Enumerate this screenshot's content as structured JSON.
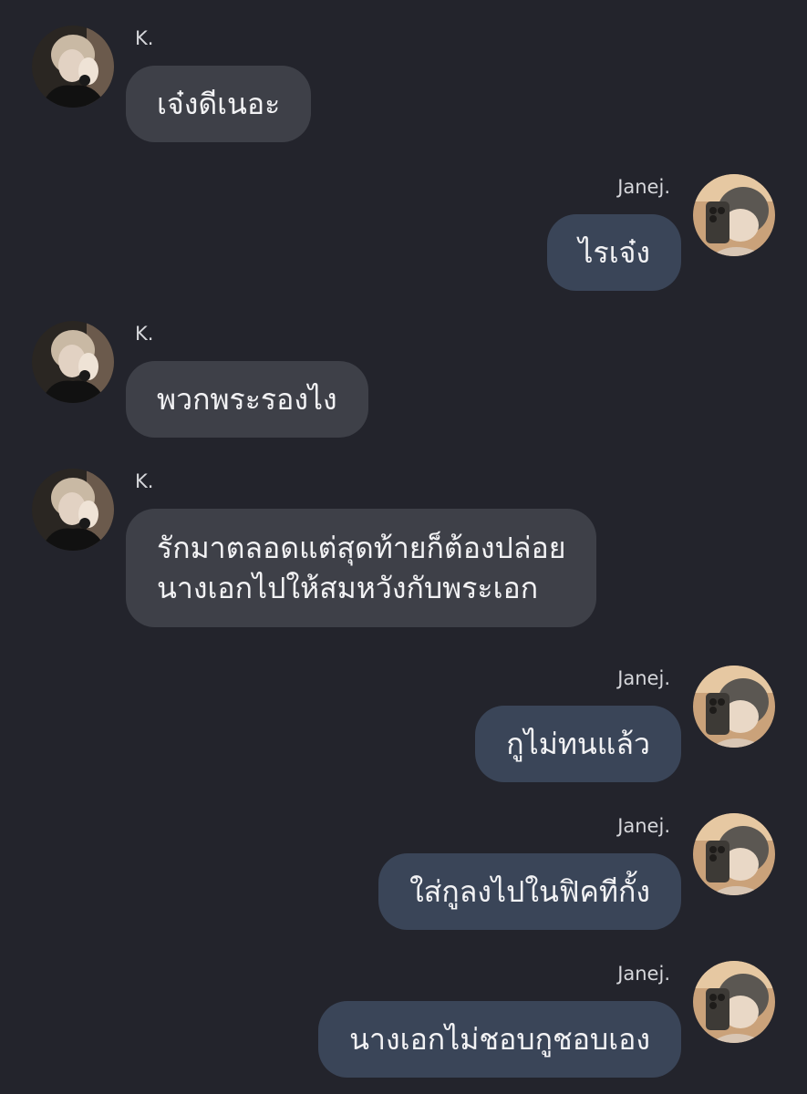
{
  "colors": {
    "background": "#23242c",
    "incoming_bubble": "#3e4048",
    "outgoing_bubble": "#3a4558",
    "text": "#f2f2f4"
  },
  "contacts": {
    "k": {
      "name": "K.",
      "avatar_icon": "profile-photo-k"
    },
    "janej": {
      "name": "Janej.",
      "avatar_icon": "profile-photo-janej"
    }
  },
  "messages": [
    {
      "sender": "K.",
      "direction": "incoming",
      "lines": [
        "เจ๋งดีเนอะ"
      ]
    },
    {
      "sender": "Janej.",
      "direction": "outgoing",
      "lines": [
        "ไรเจ๋ง"
      ]
    },
    {
      "sender": "K.",
      "direction": "incoming",
      "lines": [
        "พวกพระรองไง"
      ]
    },
    {
      "sender": "K.",
      "direction": "incoming",
      "lines": [
        "รักมาตลอดแต่สุดท้ายก็ต้องปล่อย",
        "นางเอกไปให้สมหวังกับพระเอก"
      ]
    },
    {
      "sender": "Janej.",
      "direction": "outgoing",
      "lines": [
        "กูไม่ทนแล้ว"
      ]
    },
    {
      "sender": "Janej.",
      "direction": "outgoing",
      "lines": [
        "ใส่กูลงไปในฟิคทีกั้ง"
      ]
    },
    {
      "sender": "Janej.",
      "direction": "outgoing",
      "lines": [
        "นางเอกไม่ชอบกูชอบเอง"
      ]
    }
  ]
}
